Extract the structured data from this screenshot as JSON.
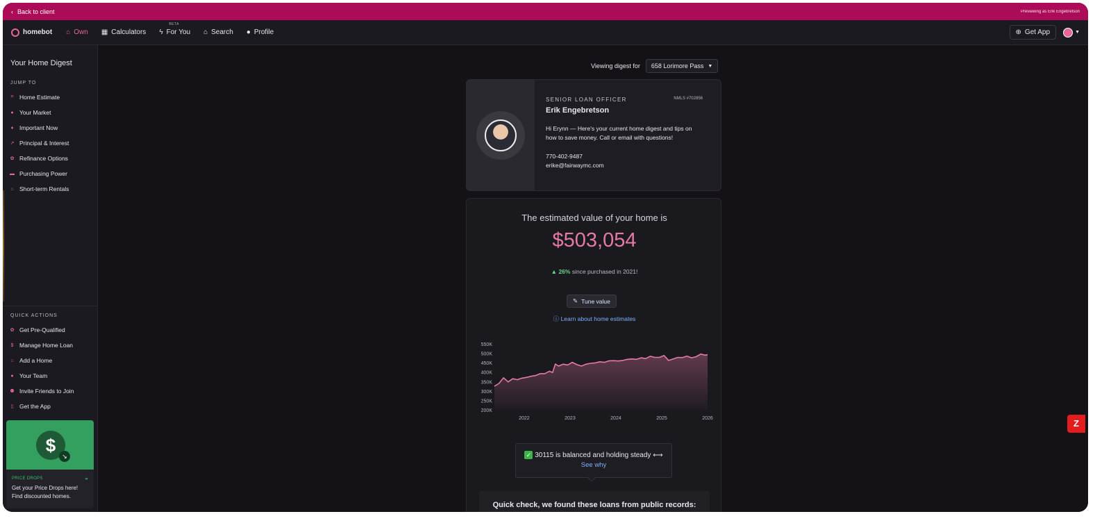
{
  "topbar": {
    "back_label": "Back to client",
    "preview_label": "Previewing as Erik Engebretson"
  },
  "nav": {
    "logo": "homebot",
    "items": [
      {
        "label": "Own",
        "icon": "house-icon"
      },
      {
        "label": "Calculators",
        "icon": "calculator-icon"
      },
      {
        "label": "For You",
        "icon": "bolt-icon",
        "badge": "BETA"
      },
      {
        "label": "Search",
        "icon": "home-search-icon"
      },
      {
        "label": "Profile",
        "icon": "person-icon"
      }
    ],
    "get_app": "Get App"
  },
  "sidebar": {
    "title": "Your Home Digest",
    "jump_label": "JUMP TO",
    "jump_items": [
      {
        "label": "Home Estimate",
        "icon": "chart-icon"
      },
      {
        "label": "Your Market",
        "icon": "pin-icon"
      },
      {
        "label": "Important Now",
        "icon": "diamond-icon"
      },
      {
        "label": "Principal & Interest",
        "icon": "trend-icon"
      },
      {
        "label": "Refinance Options",
        "icon": "badge-icon"
      },
      {
        "label": "Purchasing Power",
        "icon": "wallet-icon"
      },
      {
        "label": "Short-term Rentals",
        "icon": "rental-icon"
      }
    ],
    "quick_label": "QUICK ACTIONS",
    "quick_items": [
      {
        "label": "Get Pre-Qualified",
        "icon": "ribbon-icon"
      },
      {
        "label": "Manage Home Loan",
        "icon": "dollar-icon"
      },
      {
        "label": "Add a Home",
        "icon": "house-plus-icon"
      },
      {
        "label": "Your Team",
        "icon": "person-icon"
      },
      {
        "label": "Invite Friends to Join",
        "icon": "people-icon"
      },
      {
        "label": "Get the App",
        "icon": "phone-icon"
      }
    ],
    "promo": {
      "label": "PRICE DROPS",
      "text": "Get your Price Drops here! Find discounted homes."
    }
  },
  "viewing": {
    "label": "Viewing digest for",
    "address": "658 Lorimore Pass"
  },
  "loan_officer": {
    "role": "SENIOR LOAN OFFICER",
    "nmls": "NMLS #702856",
    "name": "Erik Engebretson",
    "message": "Hi Erynn — Here's your current home digest and tips on how to save money. Call or email with questions!",
    "phone": "770-402-9487",
    "email": "erike@fairwaymc.com"
  },
  "estimate": {
    "title": "The estimated value of your home is",
    "value": "$503,054",
    "change_pct": "26%",
    "change_text": "since purchased in 2021!",
    "tune_label": "Tune value",
    "learn_label": "Learn about home estimates"
  },
  "chart_data": {
    "type": "area",
    "title": "",
    "xlabel": "",
    "ylabel": "",
    "ylim": [
      200,
      550
    ],
    "yticks": [
      "550K",
      "500K",
      "450K",
      "400K",
      "350K",
      "300K",
      "250K",
      "200K"
    ],
    "ytick_values": [
      550,
      500,
      450,
      400,
      350,
      300,
      250,
      200
    ],
    "xticks": [
      "2022",
      "2023",
      "2024",
      "2025",
      "2026"
    ],
    "xtick_values": [
      2022,
      2023,
      2024,
      2025,
      2026
    ],
    "xlim": [
      2021.35,
      2026
    ],
    "color": "#e57aa5",
    "x": [
      2021.35,
      2021.45,
      2021.55,
      2021.65,
      2021.75,
      2021.85,
      2021.95,
      2022.05,
      2022.15,
      2022.25,
      2022.35,
      2022.45,
      2022.55,
      2022.62,
      2022.68,
      2022.75,
      2022.85,
      2022.95,
      2023.05,
      2023.15,
      2023.25,
      2023.35,
      2023.45,
      2023.55,
      2023.65,
      2023.75,
      2023.85,
      2023.95,
      2024.05,
      2024.15,
      2024.25,
      2024.35,
      2024.45,
      2024.55,
      2024.65,
      2024.75,
      2024.85,
      2024.95,
      2025.05,
      2025.15,
      2025.25,
      2025.35,
      2025.45,
      2025.55,
      2025.65,
      2025.75,
      2025.85,
      2025.95,
      2026.0
    ],
    "values": [
      325,
      340,
      370,
      348,
      365,
      360,
      368,
      372,
      378,
      382,
      392,
      392,
      405,
      398,
      443,
      432,
      442,
      438,
      452,
      440,
      432,
      442,
      447,
      449,
      455,
      452,
      460,
      461,
      459,
      462,
      468,
      470,
      468,
      476,
      472,
      484,
      478,
      478,
      488,
      462,
      470,
      478,
      477,
      485,
      476,
      482,
      496,
      490,
      492
    ]
  },
  "market": {
    "status": "30115 is balanced and holding steady",
    "see_why": "See why"
  },
  "quick_check": "Quick check, we found these loans from public records:",
  "fab": "Z"
}
